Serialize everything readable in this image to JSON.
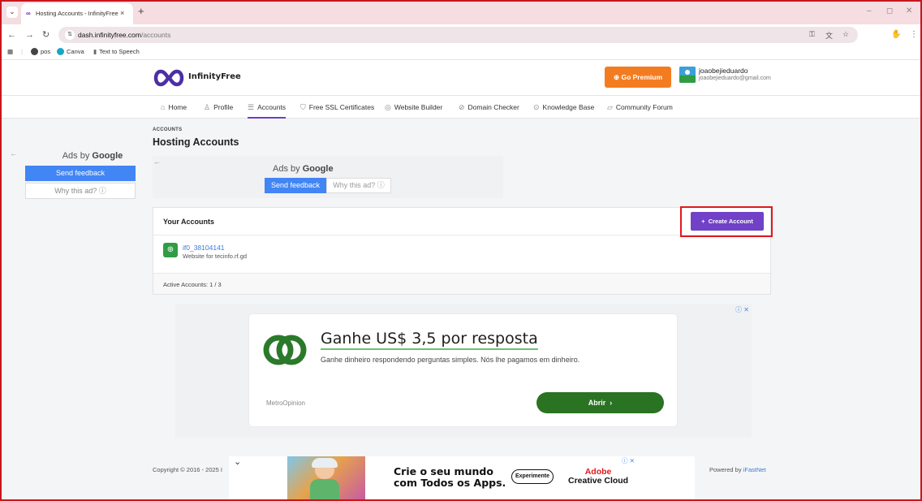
{
  "browser": {
    "tab_title": "Hosting Accounts - InfinityFree",
    "tab_favicon": "∞",
    "tab_close": "×",
    "new_tab": "+",
    "url_host": "dash.infinityfree.com",
    "url_path": "/accounts",
    "bookmarks": [
      {
        "label": "pos"
      },
      {
        "label": "Canva"
      },
      {
        "label": "Text to Speech"
      }
    ],
    "icons": {
      "tab_menu": "chevron-down-icon",
      "back": "back-arrow-icon",
      "forward": "forward-arrow-icon",
      "reload": "reload-icon",
      "apps": "apps-grid-icon",
      "password": "key-icon",
      "translate": "translate-icon",
      "bookmark": "star-icon",
      "extensions": "extension-icon",
      "menu": "kebab-menu-icon"
    }
  },
  "site": {
    "logo_text": "InfinityFree",
    "premium_label": "Go Premium",
    "user": {
      "name": "joaobejieduardo",
      "email": "joaobejieduardo@gmail.com"
    },
    "nav": [
      {
        "label": "Home",
        "icon": "home-icon"
      },
      {
        "label": "Profile",
        "icon": "user-icon"
      },
      {
        "label": "Accounts",
        "icon": "server-icon",
        "active": true
      },
      {
        "label": "Free SSL Certificates",
        "icon": "shield-icon"
      },
      {
        "label": "Website Builder",
        "icon": "palette-icon"
      },
      {
        "label": "Domain Checker",
        "icon": "check-circle-icon"
      },
      {
        "label": "Knowledge Base",
        "icon": "help-circle-icon"
      },
      {
        "label": "Community Forum",
        "icon": "chat-icon"
      }
    ],
    "colors": {
      "accent": "#7141c7",
      "premium": "#f47c20",
      "highlight": "#e0191f"
    }
  },
  "page": {
    "breadcrumb": "ACCOUNTS",
    "title": "Hosting Accounts",
    "card": {
      "title": "Your Accounts",
      "create_label": "Create Account",
      "accounts": [
        {
          "id": "if0_38104141",
          "description": "Website for tecinfo.rf.gd"
        }
      ],
      "active_accounts": "Active Accounts: 1 / 3"
    },
    "footer": {
      "copyright": "Copyright © 2016 - 2025 I",
      "powered_prefix": "Powered by ",
      "powered_link": "iFastNet"
    }
  },
  "ads": {
    "ads_by": "Ads by ",
    "google": "Google",
    "send_feedback": "Send feedback",
    "why_this_ad": "Why this ad? ⓘ",
    "banner": {
      "headline": "Ganhe US$ 3,5 por resposta",
      "subtext": "Ganhe dinheiro respondendo perguntas simples. Nós lhe pagamos em dinheiro.",
      "advertiser": "MetroOpinion",
      "cta": "Abrir",
      "choices": "ⓘ ✕"
    },
    "bottom": {
      "line1": "Crie o seu mundo",
      "line2": "com Todos os Apps.",
      "button": "Experimente",
      "brand1": "Adobe",
      "brand2": "Creative Cloud",
      "choices": "ⓘ ✕"
    }
  }
}
